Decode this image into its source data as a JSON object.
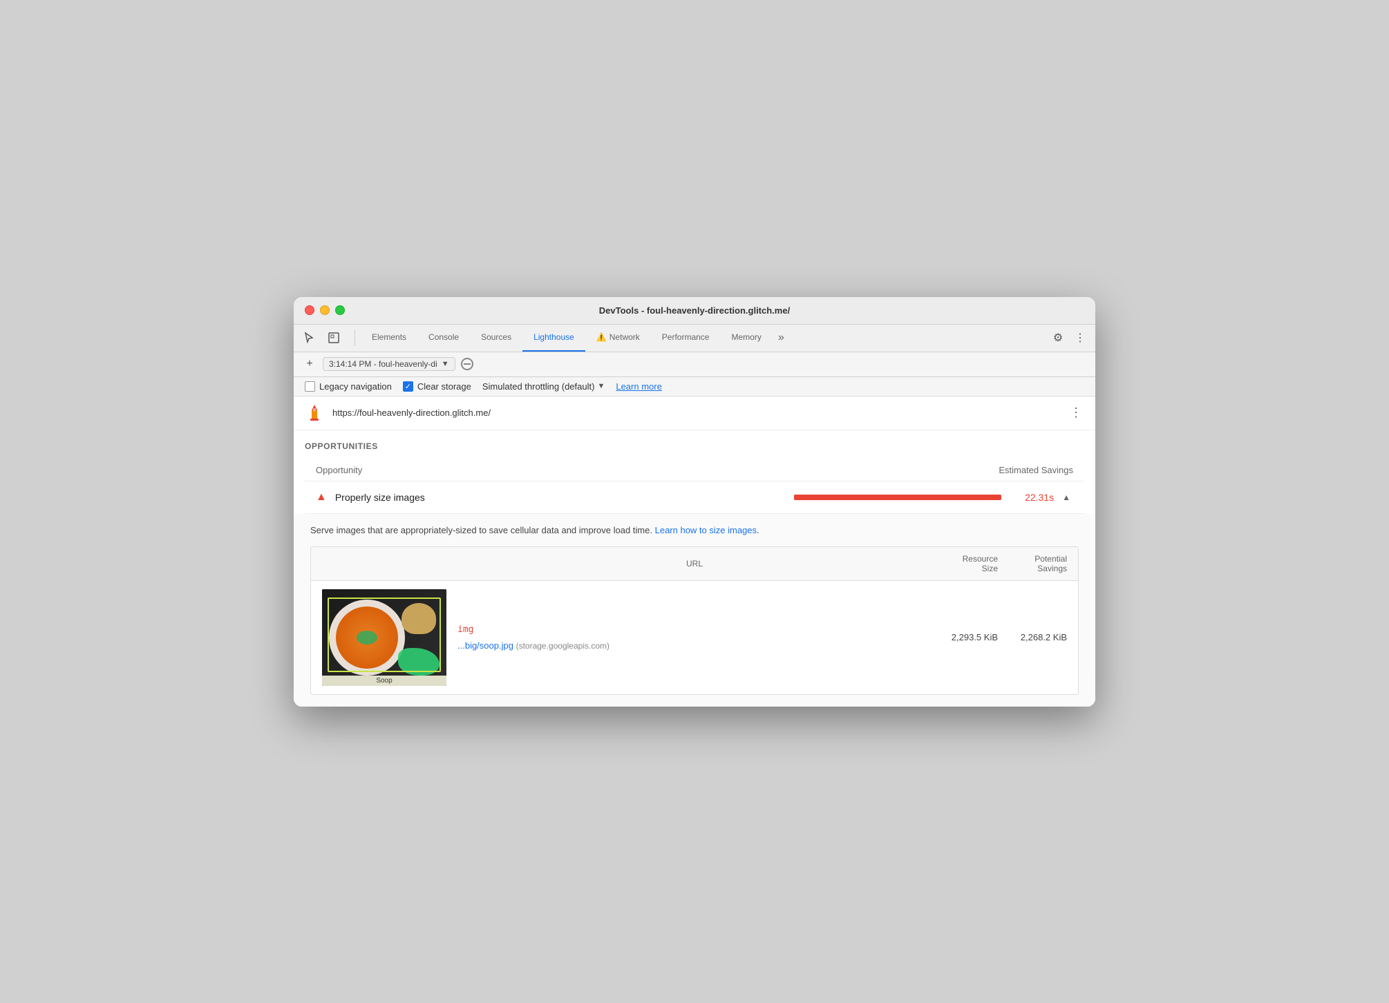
{
  "window": {
    "title": "DevTools - foul-heavenly-direction.glitch.me/"
  },
  "traffic_lights": {
    "red_label": "close",
    "yellow_label": "minimize",
    "green_label": "maximize"
  },
  "toolbar": {
    "cursor_icon": "⊹",
    "inspector_icon": "⬚",
    "tabs": [
      {
        "label": "Elements",
        "active": false,
        "warning": false
      },
      {
        "label": "Console",
        "active": false,
        "warning": false
      },
      {
        "label": "Sources",
        "active": false,
        "warning": false
      },
      {
        "label": "Lighthouse",
        "active": true,
        "warning": false
      },
      {
        "label": "Network",
        "active": false,
        "warning": true
      },
      {
        "label": "Performance",
        "active": false,
        "warning": false
      },
      {
        "label": "Memory",
        "active": false,
        "warning": false
      }
    ],
    "more_tabs_label": "»",
    "settings_icon": "⚙",
    "more_options_icon": "⋮"
  },
  "second_toolbar": {
    "add_icon": "+",
    "timestamp": "3:14:14 PM - foul-heavenly-di",
    "dropdown_arrow": "▼",
    "no_entry_icon": "⊘"
  },
  "options_bar": {
    "legacy_navigation_label": "Legacy navigation",
    "legacy_navigation_checked": false,
    "clear_storage_label": "Clear storage",
    "clear_storage_checked": true,
    "throttling_label": "Simulated throttling (default)",
    "dropdown_arrow": "▼",
    "learn_more_label": "Learn more"
  },
  "url_bar": {
    "url": "https://foul-heavenly-direction.glitch.me/",
    "more_icon": "⋮"
  },
  "opportunities": {
    "section_title": "OPPORTUNITIES",
    "col_opportunity": "Opportunity",
    "col_estimated_savings": "Estimated Savings",
    "items": [
      {
        "name": "Properly size images",
        "warning_icon": "▲",
        "savings_value": "22.31s",
        "bar_color": "#ea4335",
        "expanded": true
      }
    ]
  },
  "expanded": {
    "description": "Serve images that are appropriately-sized to save cellular data and improve load time.",
    "learn_link_label": "Learn how to size images",
    "col_url": "URL",
    "col_resource_size": "Resource\nSize",
    "col_potential_savings": "Potential\nSavings",
    "rows": [
      {
        "img_tag": "img",
        "filename": "...big/soop.jpg",
        "domain": "(storage.googleapis.com)",
        "resource_size": "2,293.5 KiB",
        "potential_savings": "2,268.2 KiB",
        "soup_label": "Soop"
      }
    ]
  },
  "colors": {
    "accent_blue": "#1a73e8",
    "danger_red": "#ea4335",
    "active_tab_underline": "#1a73e8"
  }
}
